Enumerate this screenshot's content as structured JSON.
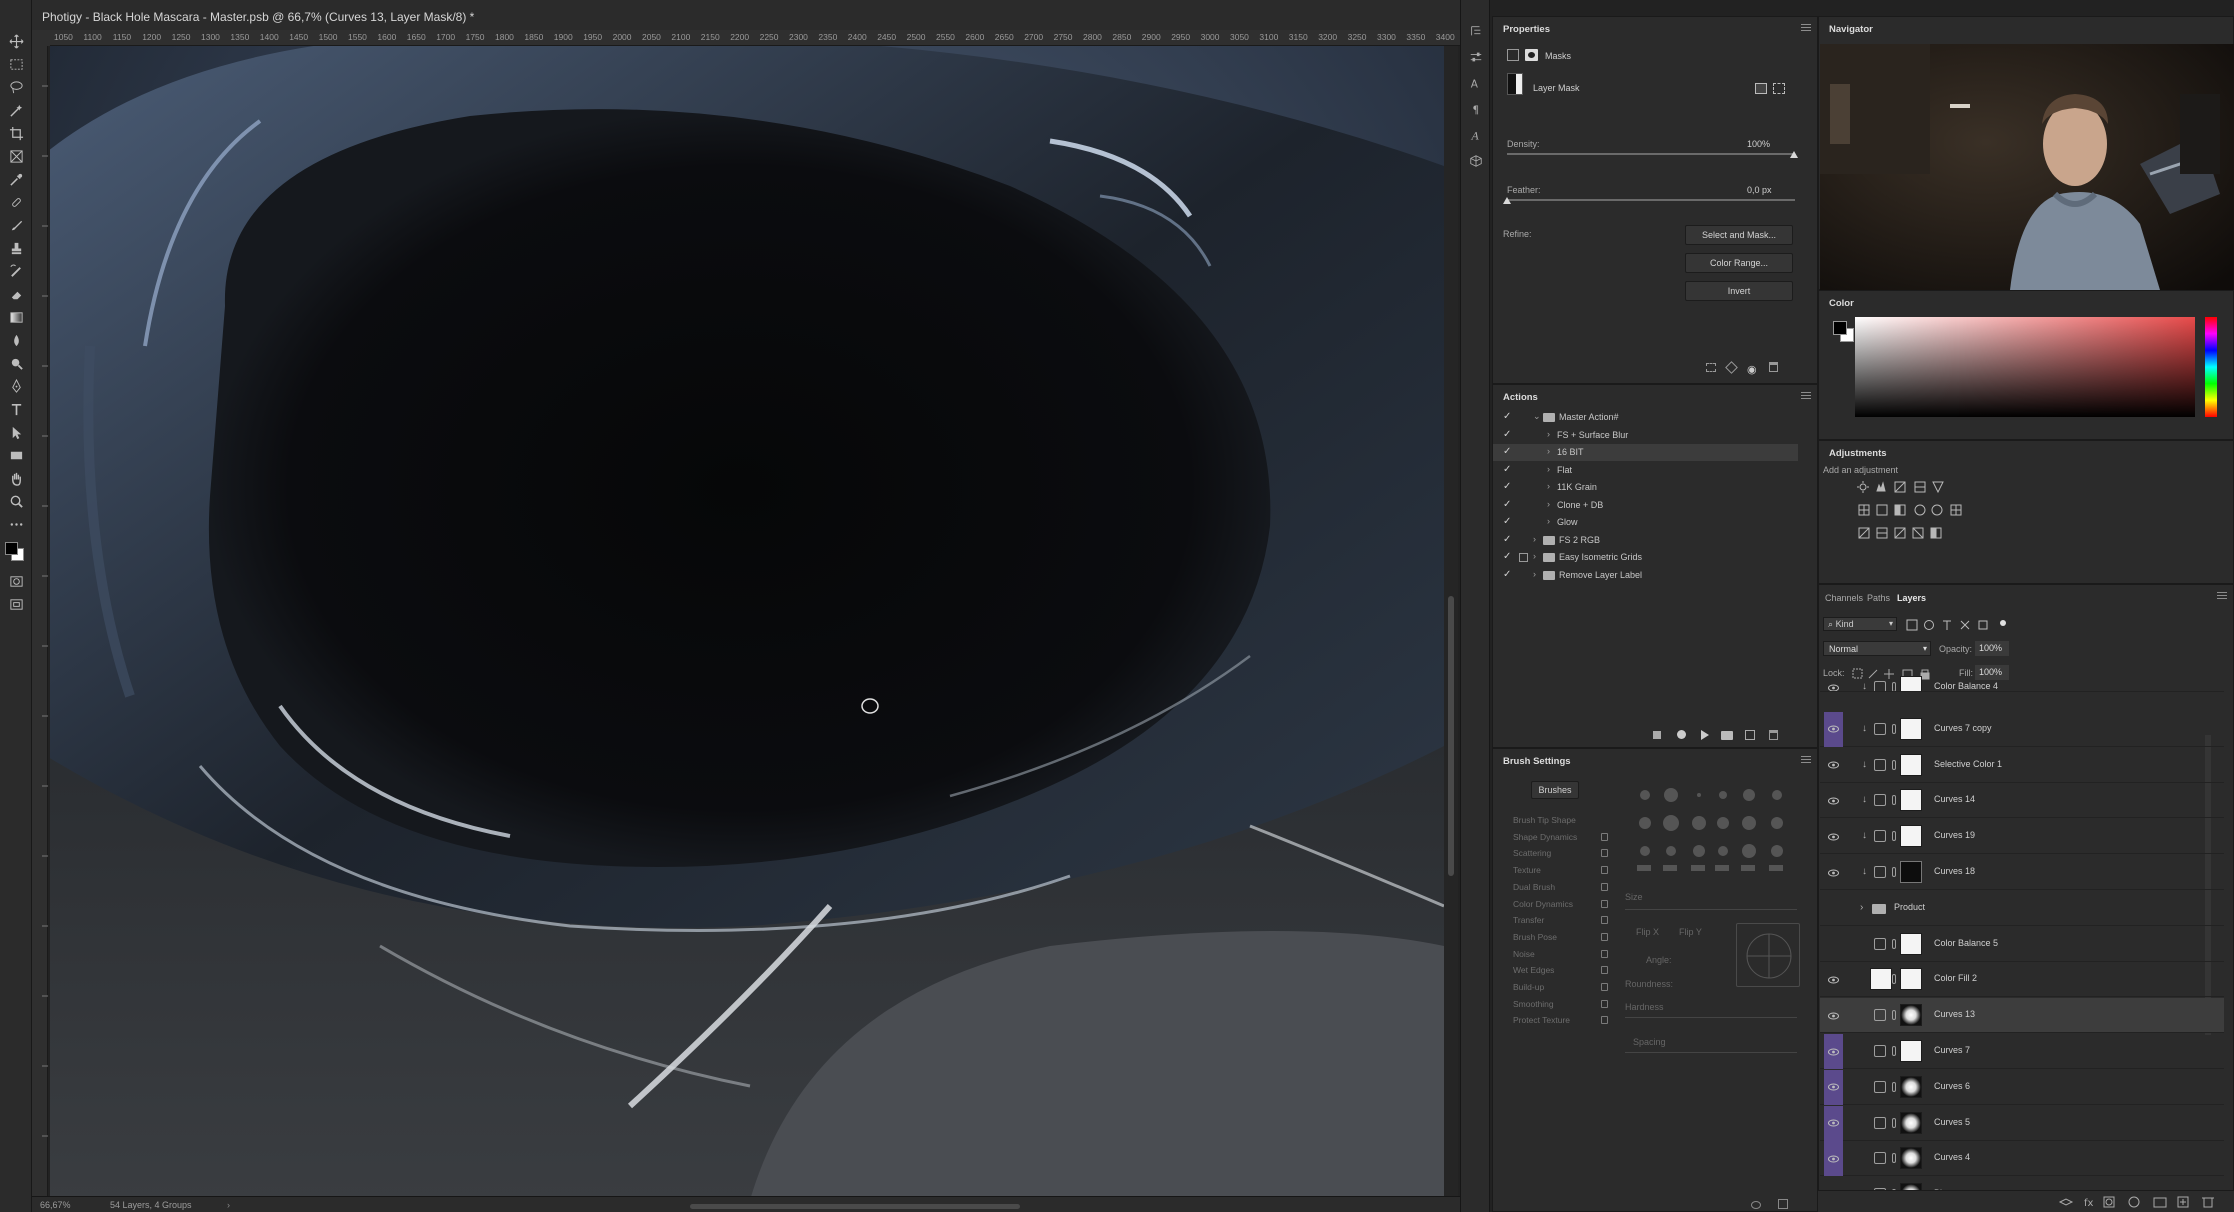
{
  "document": {
    "title": "Photigy - Black Hole Mascara - Master.psb @ 66,7% (Curves 13, Layer Mask/8) *",
    "zoom": "66,67%",
    "info": "54 Layers, 4 Groups"
  },
  "ruler": {
    "ticks": [
      "1050",
      "1100",
      "1150",
      "1200",
      "1250",
      "1300",
      "1350",
      "1400",
      "1450",
      "1500",
      "1550",
      "1600",
      "1650",
      "1700",
      "1750",
      "1800",
      "1850",
      "1900",
      "1950",
      "2000",
      "2050",
      "2100",
      "2150",
      "2200",
      "2250",
      "2300",
      "2350",
      "2400",
      "2450",
      "2500",
      "2550",
      "2600",
      "2650",
      "2700",
      "2750",
      "2800",
      "2850",
      "2900",
      "2950",
      "3000",
      "3050",
      "3100",
      "3150",
      "3200",
      "3250",
      "3300",
      "3350",
      "3400"
    ]
  },
  "properties": {
    "title": "Properties",
    "masks_label": "Masks",
    "mask_type": "Layer Mask",
    "density_label": "Density:",
    "density_value": "100%",
    "density_level": 1.0,
    "feather_label": "Feather:",
    "feather_value": "0,0 px",
    "feather_level": 0.0,
    "refine_label": "Refine:",
    "select_and_mask": "Select and Mask...",
    "color_range": "Color Range...",
    "invert": "Invert"
  },
  "actions": {
    "title": "Actions",
    "items": [
      {
        "label": "Master Action#",
        "type": "set",
        "indent": 0,
        "expanded": true
      },
      {
        "label": "FS + Surface Blur",
        "type": "action",
        "indent": 1
      },
      {
        "label": "16 BIT",
        "type": "action",
        "indent": 1,
        "selected": true
      },
      {
        "label": "Flat",
        "type": "action",
        "indent": 1
      },
      {
        "label": "11K Grain",
        "type": "action",
        "indent": 1
      },
      {
        "label": "Clone + DB",
        "type": "action",
        "indent": 1
      },
      {
        "label": "Glow",
        "type": "action",
        "indent": 1
      },
      {
        "label": "FS 2 RGB",
        "type": "set",
        "indent": 0
      },
      {
        "label": "Easy Isometric Grids",
        "type": "set",
        "indent": 0
      },
      {
        "label": "Remove Layer Label",
        "type": "set",
        "indent": 0
      }
    ]
  },
  "brush_settings": {
    "title": "Brush Settings",
    "brushes_button": "Brushes",
    "items": [
      "Brush Tip Shape",
      "Shape Dynamics",
      "Scattering",
      "Texture",
      "Dual Brush",
      "Color Dynamics",
      "Transfer",
      "Brush Pose",
      "Noise",
      "Wet Edges",
      "Build-up",
      "Smoothing",
      "Protect Texture"
    ],
    "size_label": "Size",
    "flip_x": "Flip X",
    "flip_y": "Flip Y",
    "angle_label": "Angle:",
    "roundness_label": "Roundness:",
    "hardness_label": "Hardness",
    "spacing_label": "Spacing"
  },
  "navigator": {
    "title": "Navigator"
  },
  "color_panel": {
    "title": "Color",
    "foreground": "#000000",
    "background": "#ffffff",
    "hue_color": "#e84a4a"
  },
  "adjustments": {
    "title": "Adjustments",
    "subtitle": "Add an adjustment"
  },
  "layers_panel": {
    "tabs": [
      "Channels",
      "Paths",
      "Layers"
    ],
    "active_tab": "Layers",
    "filter_kind": "Kind",
    "blend_mode": "Normal",
    "opacity_label": "Opacity:",
    "opacity_value": "100%",
    "lock_label": "Lock:",
    "fill_label": "Fill:",
    "fill_value": "100%",
    "layers": [
      {
        "name": "Color Balance 4",
        "eye": true,
        "purple": false,
        "clip": true,
        "thumb": "white",
        "partial": true
      },
      {
        "name": "Curves 7 copy",
        "eye": true,
        "purple": true,
        "clip": true,
        "thumb": "white"
      },
      {
        "name": "Selective Color 1",
        "eye": true,
        "purple": false,
        "clip": true,
        "thumb": "white"
      },
      {
        "name": "Curves 14",
        "eye": true,
        "purple": false,
        "clip": true,
        "thumb": "white"
      },
      {
        "name": "Curves 19",
        "eye": true,
        "purple": false,
        "clip": true,
        "thumb": "white"
      },
      {
        "name": "Curves 18",
        "eye": true,
        "purple": false,
        "clip": true,
        "thumb": "black"
      },
      {
        "name": "Product",
        "eye": false,
        "purple": false,
        "group": true
      },
      {
        "name": "Color Balance 5",
        "eye": false,
        "purple": false,
        "thumb": "white"
      },
      {
        "name": "Color Fill 2",
        "eye": true,
        "purple": false,
        "thumb": "white",
        "fill": true
      },
      {
        "name": "Curves 13",
        "eye": true,
        "purple": false,
        "thumb": "mask",
        "selected": true
      },
      {
        "name": "Curves 7",
        "eye": true,
        "purple": true,
        "thumb": "white"
      },
      {
        "name": "Curves 6",
        "eye": true,
        "purple": true,
        "thumb": "mask"
      },
      {
        "name": "Curves 5",
        "eye": true,
        "purple": true,
        "thumb": "mask"
      },
      {
        "name": "Curves 4",
        "eye": true,
        "purple": true,
        "thumb": "mask"
      },
      {
        "name": "Blur",
        "eye": true,
        "purple": false,
        "thumb": "mask"
      }
    ]
  },
  "colors": {
    "panel_bg": "#2b2b2b",
    "accent_purple": "#5b4a8c",
    "canvas_dark": "#0a0b0d"
  }
}
